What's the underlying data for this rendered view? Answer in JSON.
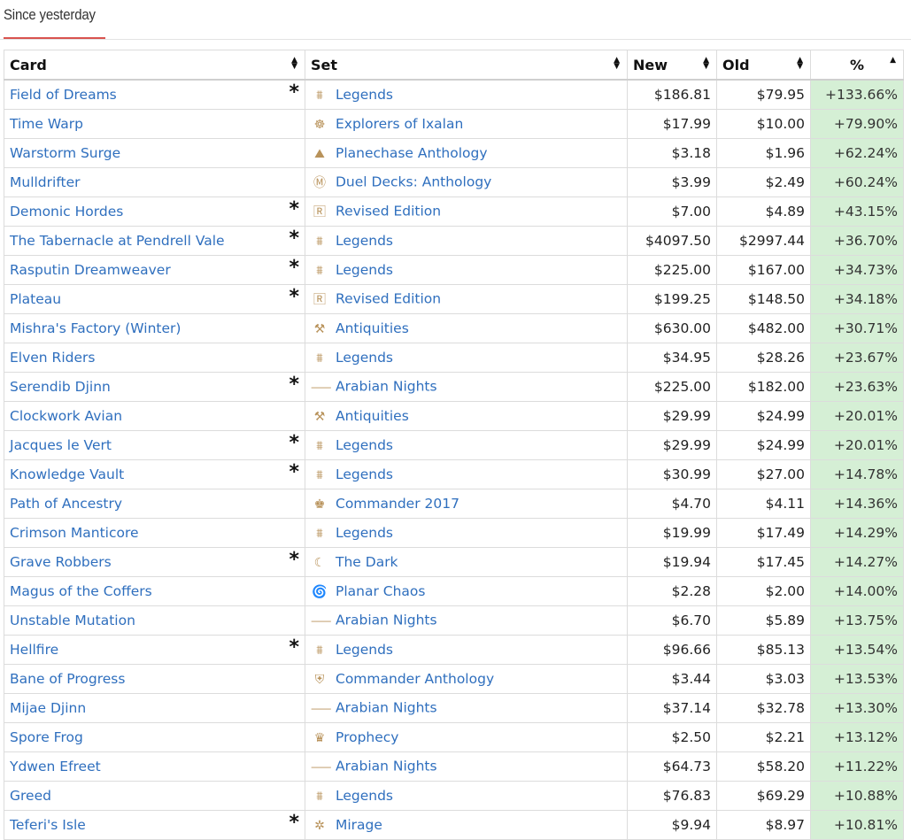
{
  "tab": {
    "label": "Since yesterday"
  },
  "colors": {
    "link": "#2f6fbe",
    "pct_bg": "#d5efd5",
    "tab_accent": "#d9534f",
    "set_icon": "#b8925a"
  },
  "headers": {
    "card": "Card",
    "set": "Set",
    "new": "New",
    "old": "Old",
    "pct": "%"
  },
  "rows": [
    {
      "card": "Field of Dreams",
      "star": "*",
      "set_icon": "column-icon",
      "glyph": "⩩",
      "set": "Legends",
      "new": "$186.81",
      "old": "$79.95",
      "pct": "+133.66%"
    },
    {
      "card": "Time Warp",
      "star": "",
      "set_icon": "sun-icon",
      "glyph": "☸",
      "set": "Explorers of Ixalan",
      "new": "$17.99",
      "old": "$10.00",
      "pct": "+79.90%"
    },
    {
      "card": "Warstorm Surge",
      "star": "",
      "set_icon": "planechase-icon",
      "glyph": "⛰",
      "set": "Planechase Anthology",
      "new": "$3.18",
      "old": "$1.96",
      "pct": "+62.24%"
    },
    {
      "card": "Mulldrifter",
      "star": "",
      "set_icon": "m-logo-icon",
      "glyph": "Ⓜ",
      "set": "Duel Decks: Anthology",
      "new": "$3.99",
      "old": "$2.49",
      "pct": "+60.24%"
    },
    {
      "card": "Demonic Hordes",
      "star": "*",
      "set_icon": "revised-icon",
      "glyph": "🅁",
      "set": "Revised Edition",
      "new": "$7.00",
      "old": "$4.89",
      "pct": "+43.15%"
    },
    {
      "card": "The Tabernacle at Pendrell Vale",
      "star": "*",
      "set_icon": "column-icon",
      "glyph": "⩩",
      "set": "Legends",
      "new": "$4097.50",
      "old": "$2997.44",
      "pct": "+36.70%"
    },
    {
      "card": "Rasputin Dreamweaver",
      "star": "*",
      "set_icon": "column-icon",
      "glyph": "⩩",
      "set": "Legends",
      "new": "$225.00",
      "old": "$167.00",
      "pct": "+34.73%"
    },
    {
      "card": "Plateau",
      "star": "*",
      "set_icon": "revised-icon",
      "glyph": "🅁",
      "set": "Revised Edition",
      "new": "$199.25",
      "old": "$148.50",
      "pct": "+34.18%"
    },
    {
      "card": "Mishra's Factory (Winter)",
      "star": "",
      "set_icon": "anvil-icon",
      "glyph": "⚒",
      "set": "Antiquities",
      "new": "$630.00",
      "old": "$482.00",
      "pct": "+30.71%"
    },
    {
      "card": "Elven Riders",
      "star": "",
      "set_icon": "column-icon",
      "glyph": "⩩",
      "set": "Legends",
      "new": "$34.95",
      "old": "$28.26",
      "pct": "+23.67%"
    },
    {
      "card": "Serendib Djinn",
      "star": "*",
      "set_icon": "scimitar-icon",
      "glyph": "⸺",
      "set": "Arabian Nights",
      "new": "$225.00",
      "old": "$182.00",
      "pct": "+23.63%"
    },
    {
      "card": "Clockwork Avian",
      "star": "",
      "set_icon": "anvil-icon",
      "glyph": "⚒",
      "set": "Antiquities",
      "new": "$29.99",
      "old": "$24.99",
      "pct": "+20.01%"
    },
    {
      "card": "Jacques le Vert",
      "star": "*",
      "set_icon": "column-icon",
      "glyph": "⩩",
      "set": "Legends",
      "new": "$29.99",
      "old": "$24.99",
      "pct": "+20.01%"
    },
    {
      "card": "Knowledge Vault",
      "star": "*",
      "set_icon": "column-icon",
      "glyph": "⩩",
      "set": "Legends",
      "new": "$30.99",
      "old": "$27.00",
      "pct": "+14.78%"
    },
    {
      "card": "Path of Ancestry",
      "star": "",
      "set_icon": "commander-icon",
      "glyph": "♚",
      "set": "Commander 2017",
      "new": "$4.70",
      "old": "$4.11",
      "pct": "+14.36%"
    },
    {
      "card": "Crimson Manticore",
      "star": "",
      "set_icon": "column-icon",
      "glyph": "⩩",
      "set": "Legends",
      "new": "$19.99",
      "old": "$17.49",
      "pct": "+14.29%"
    },
    {
      "card": "Grave Robbers",
      "star": "*",
      "set_icon": "moon-icon",
      "glyph": "☾",
      "set": "The Dark",
      "new": "$19.94",
      "old": "$17.45",
      "pct": "+14.27%"
    },
    {
      "card": "Magus of the Coffers",
      "star": "",
      "set_icon": "spiral-icon",
      "glyph": "🌀",
      "set": "Planar Chaos",
      "new": "$2.28",
      "old": "$2.00",
      "pct": "+14.00%"
    },
    {
      "card": "Unstable Mutation",
      "star": "",
      "set_icon": "scimitar-icon",
      "glyph": "⸺",
      "set": "Arabian Nights",
      "new": "$6.70",
      "old": "$5.89",
      "pct": "+13.75%"
    },
    {
      "card": "Hellfire",
      "star": "*",
      "set_icon": "column-icon",
      "glyph": "⩩",
      "set": "Legends",
      "new": "$96.66",
      "old": "$85.13",
      "pct": "+13.54%"
    },
    {
      "card": "Bane of Progress",
      "star": "",
      "set_icon": "shield-icon",
      "glyph": "⛨",
      "set": "Commander Anthology",
      "new": "$3.44",
      "old": "$3.03",
      "pct": "+13.53%"
    },
    {
      "card": "Mijae Djinn",
      "star": "",
      "set_icon": "scimitar-icon",
      "glyph": "⸺",
      "set": "Arabian Nights",
      "new": "$37.14",
      "old": "$32.78",
      "pct": "+13.30%"
    },
    {
      "card": "Spore Frog",
      "star": "",
      "set_icon": "crystal-icon",
      "glyph": "♛",
      "set": "Prophecy",
      "new": "$2.50",
      "old": "$2.21",
      "pct": "+13.12%"
    },
    {
      "card": "Ydwen Efreet",
      "star": "",
      "set_icon": "scimitar-icon",
      "glyph": "⸺",
      "set": "Arabian Nights",
      "new": "$64.73",
      "old": "$58.20",
      "pct": "+11.22%"
    },
    {
      "card": "Greed",
      "star": "",
      "set_icon": "column-icon",
      "glyph": "⩩",
      "set": "Legends",
      "new": "$76.83",
      "old": "$69.29",
      "pct": "+10.88%"
    },
    {
      "card": "Teferi's Isle",
      "star": "*",
      "set_icon": "palm-icon",
      "glyph": "✲",
      "set": "Mirage",
      "new": "$9.94",
      "old": "$8.97",
      "pct": "+10.81%"
    }
  ]
}
